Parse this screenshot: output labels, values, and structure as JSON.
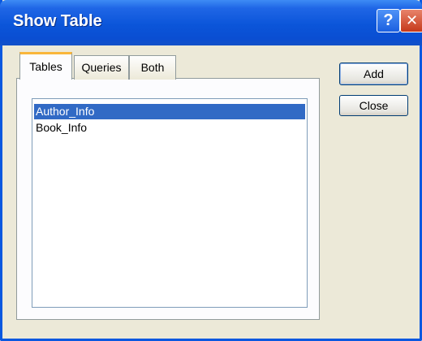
{
  "window": {
    "title": "Show Table",
    "help_glyph": "?",
    "close_glyph": "✕"
  },
  "tabs": [
    {
      "label": "Tables",
      "selected": true
    },
    {
      "label": "Queries",
      "selected": false
    },
    {
      "label": "Both",
      "selected": false
    }
  ],
  "list": {
    "items": [
      {
        "label": "Author_Info",
        "selected": true
      },
      {
        "label": "Book_Info",
        "selected": false
      }
    ]
  },
  "buttons": {
    "add_label": "Add",
    "close_label": "Close"
  },
  "colors": {
    "titlebar": "#0b55d9",
    "selection": "#316ac5",
    "tab_accent": "#f9b63b",
    "dialog_bg": "#ece9d8"
  }
}
